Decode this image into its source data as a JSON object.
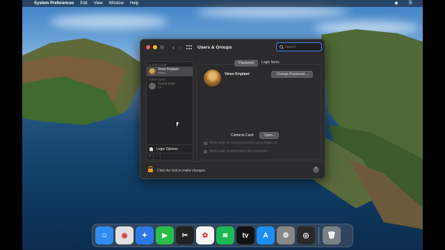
{
  "menubar": {
    "apple": "",
    "app_name": "System Preferences",
    "menus": [
      "Edit",
      "View",
      "Window",
      "Help"
    ]
  },
  "window": {
    "title": "Users & Groups",
    "search_placeholder": "Search",
    "sidebar": {
      "current_user_label": "Current User",
      "current_user": {
        "name": "Viren Kriplani",
        "role": "Admin"
      },
      "other_users_label": "Other Users",
      "other_users": [
        {
          "name": "Guest User",
          "role": "Off"
        }
      ],
      "login_options_label": "Login Options",
      "add_label": "+",
      "remove_label": "−"
    },
    "tabs": [
      {
        "label": "Password",
        "active": true
      },
      {
        "label": "Login Items",
        "active": false
      }
    ],
    "main": {
      "user_name": "Viren Kriplani",
      "change_password_label": "Change Password...",
      "contacts_card_label": "Contacts Card:",
      "open_label": "Open...",
      "checkboxes": [
        {
          "label": "Allow user to reset password using Apple ID",
          "checked": false,
          "enabled": false
        },
        {
          "label": "Allow user to administer this computer",
          "checked": true,
          "enabled": false
        }
      ]
    },
    "footer": {
      "lock_text": "Click the lock to make changes.",
      "help_label": "?"
    }
  },
  "dock": {
    "apps": [
      {
        "name": "Finder",
        "glyph": "☺",
        "color": "#2f8df0"
      },
      {
        "name": "Chrome",
        "glyph": "◉",
        "color": "#e0e0e0"
      },
      {
        "name": "Safari",
        "glyph": "✦",
        "color": "#2b79e6"
      },
      {
        "name": "FaceTime",
        "glyph": "▶",
        "color": "#2bbd4a"
      },
      {
        "name": "Final Cut Pro",
        "glyph": "✂",
        "color": "#222222"
      },
      {
        "name": "Photos",
        "glyph": "✿",
        "color": "#f5f5f5"
      },
      {
        "name": "Spotify",
        "glyph": "≋",
        "color": "#1db954"
      },
      {
        "name": "TV",
        "glyph": "tv",
        "color": "#111111"
      },
      {
        "name": "App Store",
        "glyph": "A",
        "color": "#1c8ff5"
      },
      {
        "name": "System Preferences",
        "glyph": "⚙",
        "color": "#888888"
      },
      {
        "name": "OBS",
        "glyph": "◎",
        "color": "#2a2a2a"
      },
      {
        "name": "Trash",
        "glyph": "🗑",
        "color": "#7a8088"
      }
    ]
  }
}
